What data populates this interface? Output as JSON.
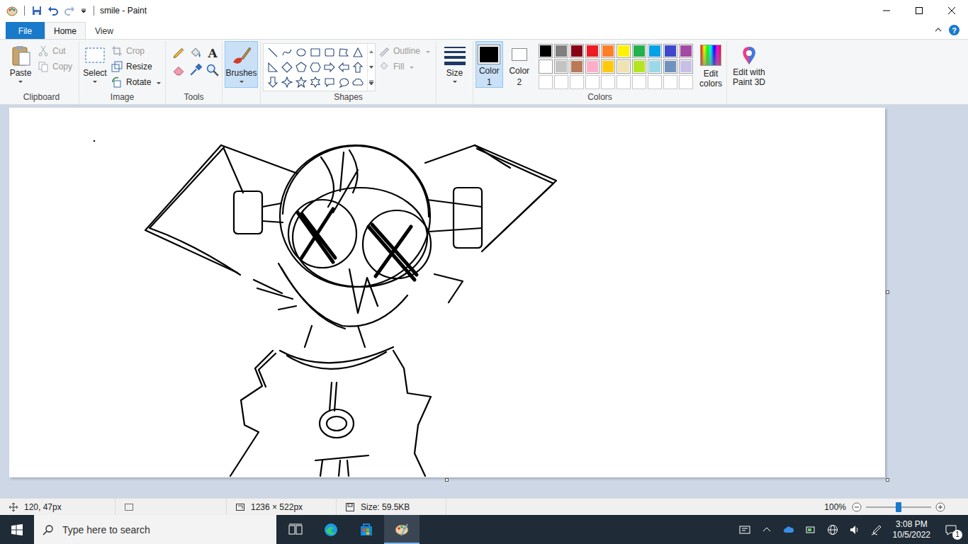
{
  "window": {
    "title": "smile - Paint",
    "help": "?"
  },
  "tabs": [
    {
      "label": "File",
      "kind": "file",
      "selected": false
    },
    {
      "label": "Home",
      "kind": "tab",
      "selected": true
    },
    {
      "label": "View",
      "kind": "tab",
      "selected": false
    }
  ],
  "ribbon": {
    "clipboard": {
      "label": "Clipboard",
      "paste": "Paste",
      "cut": {
        "label": "Cut",
        "disabled": true
      },
      "copy": {
        "label": "Copy",
        "disabled": true
      }
    },
    "image": {
      "label": "Image",
      "select": "Select",
      "crop": {
        "label": "Crop",
        "disabled": true
      },
      "resize": {
        "label": "Resize",
        "disabled": false
      },
      "rotate": {
        "label": "Rotate",
        "disabled": false
      }
    },
    "tools": {
      "label": "Tools",
      "text_glyph": "A"
    },
    "brushes": {
      "label": "Brushes",
      "selected": true
    },
    "shapes": {
      "label": "Shapes",
      "outline": {
        "label": "Outline",
        "disabled": true
      },
      "fill": {
        "label": "Fill",
        "disabled": true
      }
    },
    "size": {
      "label": "Size"
    },
    "colors": {
      "label": "Colors",
      "color1": {
        "label": "Color",
        "number": "1",
        "color": "#000000",
        "selected": true
      },
      "color2": {
        "label": "Color",
        "number": "2",
        "color": "#ffffff",
        "selected": false
      },
      "palette": [
        [
          {
            "color": "#000000",
            "empty": false
          },
          {
            "color": "#7f7f7f",
            "empty": false
          },
          {
            "color": "#880015",
            "empty": false
          },
          {
            "color": "#ed1c24",
            "empty": false
          },
          {
            "color": "#ff7f27",
            "empty": false
          },
          {
            "color": "#fff200",
            "empty": false
          },
          {
            "color": "#22b14c",
            "empty": false
          },
          {
            "color": "#00a2e8",
            "empty": false
          },
          {
            "color": "#3f48cc",
            "empty": false
          },
          {
            "color": "#a349a4",
            "empty": false
          }
        ],
        [
          {
            "color": "#ffffff",
            "empty": false
          },
          {
            "color": "#c3c3c3",
            "empty": false
          },
          {
            "color": "#b97a57",
            "empty": false
          },
          {
            "color": "#ffaec9",
            "empty": false
          },
          {
            "color": "#ffc90e",
            "empty": false
          },
          {
            "color": "#efe4b0",
            "empty": false
          },
          {
            "color": "#b5e61d",
            "empty": false
          },
          {
            "color": "#99d9ea",
            "empty": false
          },
          {
            "color": "#7092be",
            "empty": false
          },
          {
            "color": "#c8bfe7",
            "empty": false
          }
        ],
        [
          {
            "color": "#ffffff",
            "empty": true
          },
          {
            "color": "#ffffff",
            "empty": true
          },
          {
            "color": "#ffffff",
            "empty": true
          },
          {
            "color": "#ffffff",
            "empty": true
          },
          {
            "color": "#ffffff",
            "empty": true
          },
          {
            "color": "#ffffff",
            "empty": true
          },
          {
            "color": "#ffffff",
            "empty": true
          },
          {
            "color": "#ffffff",
            "empty": true
          },
          {
            "color": "#ffffff",
            "empty": true
          },
          {
            "color": "#ffffff",
            "empty": true
          }
        ]
      ],
      "edit_colors": [
        "Edit",
        "colors"
      ]
    },
    "paint3d": [
      "Edit with",
      "Paint 3D"
    ]
  },
  "status_bar": {
    "cursor": "120, 47px",
    "canvas_size": "1236 × 522px",
    "file_size": "Size: 59.5KB",
    "zoom": {
      "label": "100%",
      "level": 0.5
    }
  },
  "taskbar": {
    "search_placeholder": "Type here to search",
    "apps": [
      {
        "kind": "task-view",
        "selected": false
      },
      {
        "kind": "edge",
        "selected": false
      },
      {
        "kind": "store",
        "selected": false
      },
      {
        "kind": "paint",
        "selected": true
      }
    ],
    "time": "3:08 PM",
    "date": "10/5/2022",
    "notifications": "1"
  }
}
